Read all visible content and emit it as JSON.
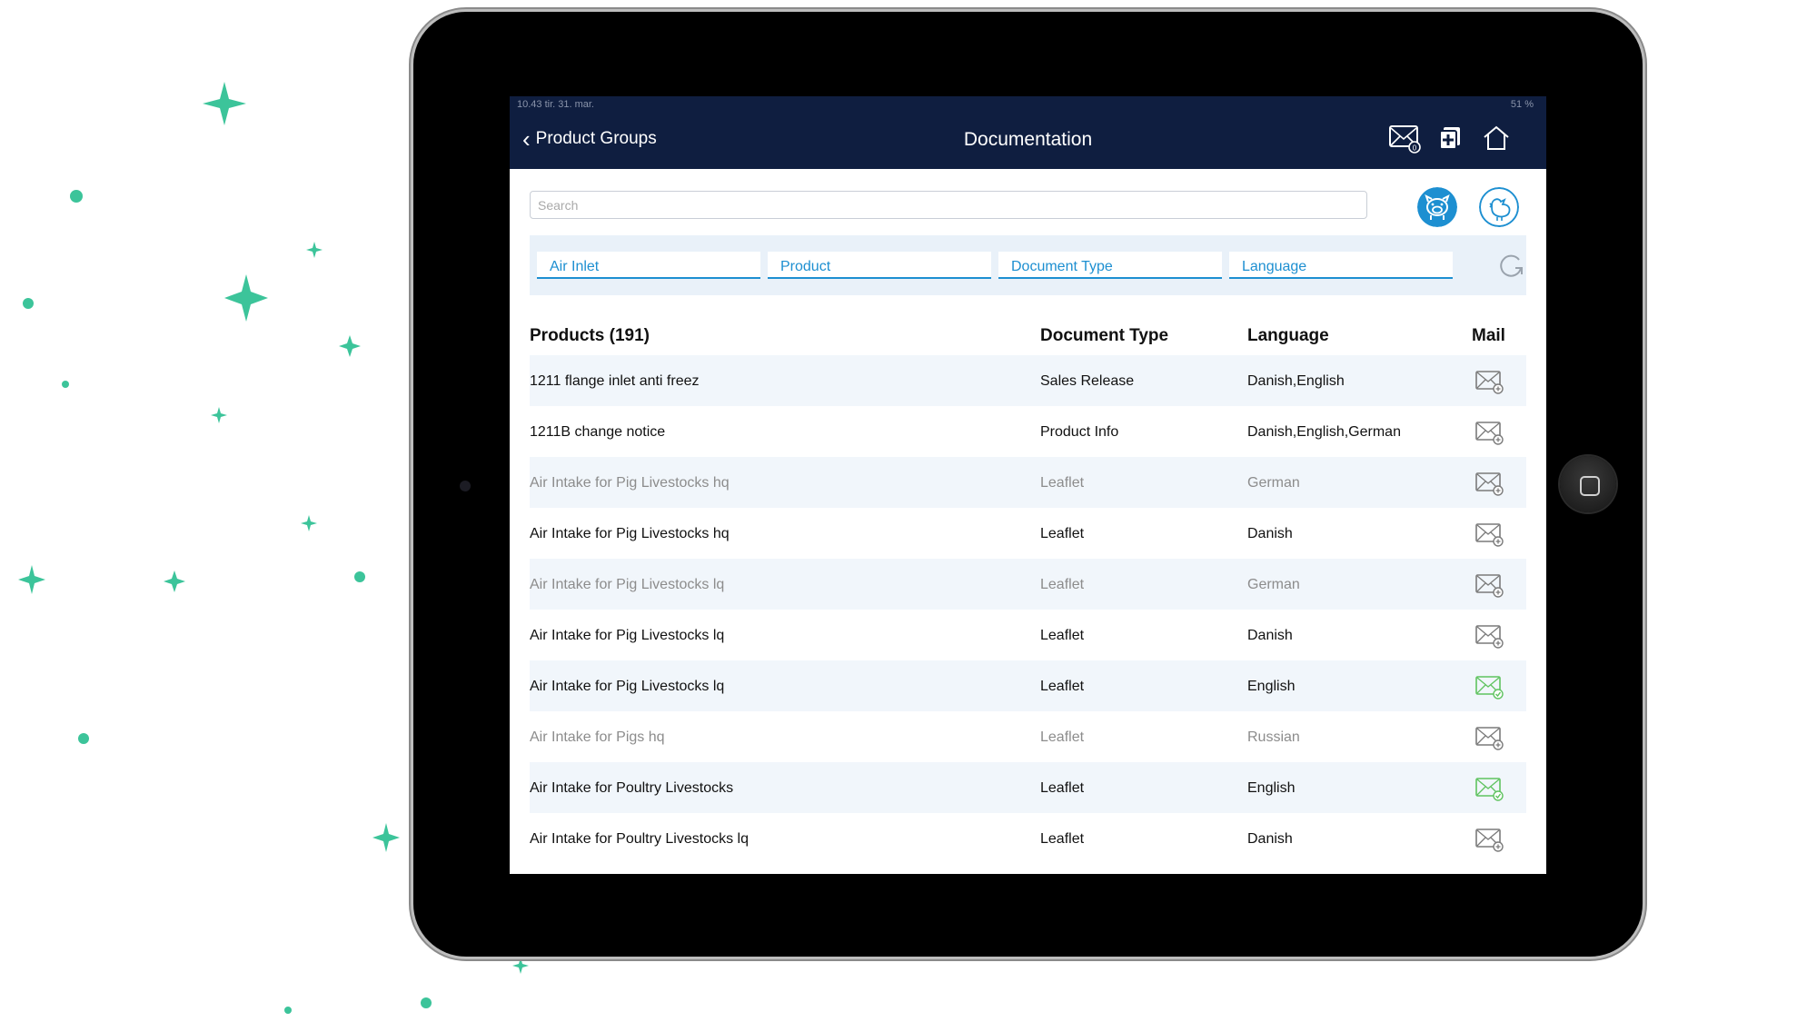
{
  "status_bar": {
    "time": "10.43  tir. 31. mar.",
    "battery": "51 %"
  },
  "nav": {
    "back_label": "Product Groups",
    "title": "Documentation"
  },
  "search": {
    "placeholder": "Search"
  },
  "filters": [
    {
      "label": "Air Inlet"
    },
    {
      "label": "Product"
    },
    {
      "label": "Document Type"
    },
    {
      "label": "Language"
    }
  ],
  "table": {
    "headers": {
      "product": "Products (191)",
      "doc_type": "Document Type",
      "language": "Language",
      "mail": "Mail"
    },
    "rows": [
      {
        "product": "1211 flange inlet anti freez",
        "doc_type": "Sales Release",
        "language": "Danish,English",
        "mail_status": "unsent",
        "dim": false
      },
      {
        "product": "1211B change notice",
        "doc_type": "Product Info",
        "language": "Danish,English,German",
        "mail_status": "unsent",
        "dim": false
      },
      {
        "product": "Air Intake for Pig Livestocks hq",
        "doc_type": "Leaflet",
        "language": "German",
        "mail_status": "unsent",
        "dim": true
      },
      {
        "product": "Air Intake for Pig Livestocks hq",
        "doc_type": "Leaflet",
        "language": "Danish",
        "mail_status": "unsent",
        "dim": false
      },
      {
        "product": "Air Intake for Pig Livestocks lq",
        "doc_type": "Leaflet",
        "language": "German",
        "mail_status": "unsent",
        "dim": true
      },
      {
        "product": "Air Intake for Pig Livestocks lq",
        "doc_type": "Leaflet",
        "language": "Danish",
        "mail_status": "unsent",
        "dim": false
      },
      {
        "product": "Air Intake for Pig Livestocks lq",
        "doc_type": "Leaflet",
        "language": "English",
        "mail_status": "added",
        "dim": false
      },
      {
        "product": "Air Intake for Pigs hq",
        "doc_type": "Leaflet",
        "language": "Russian",
        "mail_status": "unsent",
        "dim": true
      },
      {
        "product": "Air Intake for Poultry Livestocks",
        "doc_type": "Leaflet",
        "language": "English",
        "mail_status": "added",
        "dim": false
      },
      {
        "product": "Air Intake for Poultry Livestocks lq",
        "doc_type": "Leaflet",
        "language": "Danish",
        "mail_status": "unsent",
        "dim": false
      }
    ]
  },
  "colors": {
    "nav_bg": "#0f1e40",
    "accent": "#1d8fd1",
    "mail_added": "#5fc35f",
    "mail_default": "#7a7a7a",
    "sparkle": "#3cc49a"
  }
}
